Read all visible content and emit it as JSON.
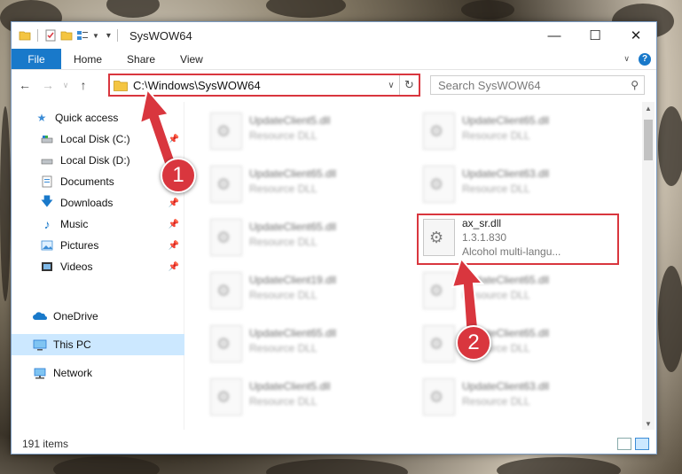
{
  "window": {
    "title": "SysWOW64"
  },
  "ribbon": {
    "file": "File",
    "tabs": [
      "Home",
      "Share",
      "View"
    ],
    "help": "?"
  },
  "nav": {
    "address": "C:\\Windows\\SysWOW64",
    "search_placeholder": "Search SysWOW64"
  },
  "sidebar": {
    "items": [
      {
        "label": "Quick access",
        "icon": "star-icon",
        "pinned": false
      },
      {
        "label": "Local Disk (C:)",
        "icon": "drive-icon",
        "pinned": true
      },
      {
        "label": "Local Disk (D:)",
        "icon": "drive-icon",
        "pinned": false
      },
      {
        "label": "Documents",
        "icon": "documents-icon",
        "pinned": true
      },
      {
        "label": "Downloads",
        "icon": "download-icon",
        "pinned": true
      },
      {
        "label": "Music",
        "icon": "music-icon",
        "pinned": true
      },
      {
        "label": "Pictures",
        "icon": "pictures-icon",
        "pinned": true
      },
      {
        "label": "Videos",
        "icon": "videos-icon",
        "pinned": true
      },
      {
        "label": "OneDrive",
        "icon": "cloud-icon",
        "pinned": false
      },
      {
        "label": "This PC",
        "icon": "computer-icon",
        "pinned": false,
        "selected": true
      },
      {
        "label": "Network",
        "icon": "network-icon",
        "pinned": false
      }
    ]
  },
  "files": [
    {
      "name": "UpdateClient5.dll",
      "sub": "Resource DLL",
      "blurred": true
    },
    {
      "name": "UpdateClient65.dll",
      "sub": "Resource DLL",
      "blurred": true
    },
    {
      "name": "UpdateClient65.dll",
      "sub": "Resource DLL",
      "blurred": true
    },
    {
      "name": "UpdateClient63.dll",
      "sub": "Resource DLL",
      "blurred": true
    },
    {
      "name": "UpdateClient65.dll",
      "sub": "Resource DLL",
      "blurred": true
    },
    {
      "name": "ax_sr.dll",
      "sub": "1.3.1.830",
      "sub2": "Alcohol multi-langu...",
      "blurred": false
    },
    {
      "name": "UpdateClient19.dll",
      "sub": "Resource DLL",
      "blurred": true
    },
    {
      "name": "UpdateClient65.dll",
      "sub": "Resource DLL",
      "blurred": true
    },
    {
      "name": "UpdateClient65.dll",
      "sub": "Resource DLL",
      "blurred": true
    },
    {
      "name": "UpdateClient65.dll",
      "sub": "Resource DLL",
      "blurred": true
    },
    {
      "name": "UpdateClient5.dll",
      "sub": "Resource DLL",
      "blurred": true
    },
    {
      "name": "UpdateClient63.dll",
      "sub": "Resource DLL",
      "blurred": true
    }
  ],
  "status": {
    "count": "191 items"
  },
  "annotations": {
    "step1": "1",
    "step2": "2"
  },
  "colors": {
    "accent": "#1979ca",
    "highlight": "#d9363e"
  }
}
